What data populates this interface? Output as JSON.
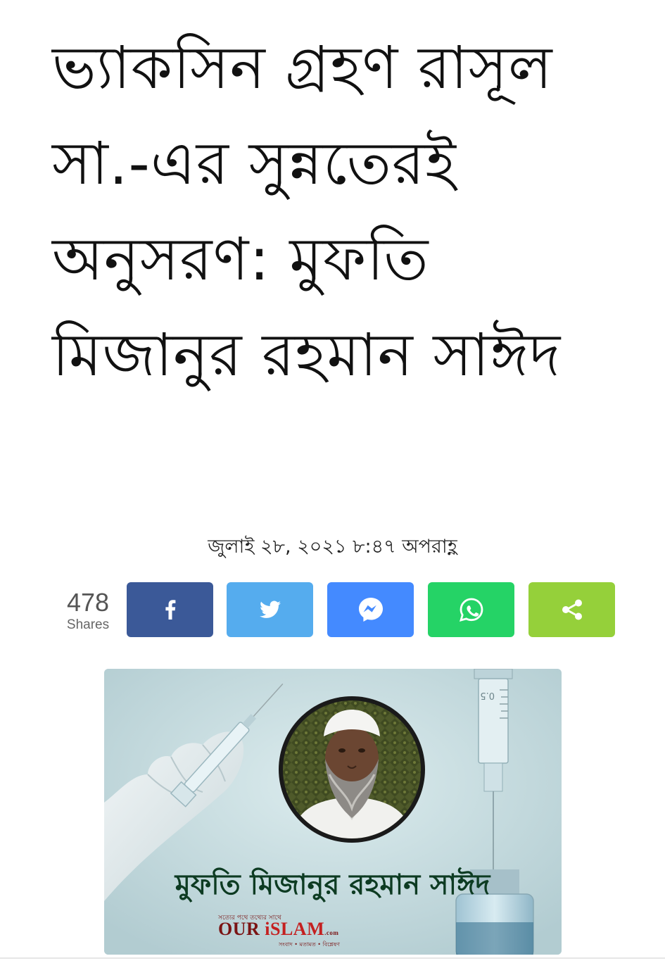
{
  "article": {
    "title": "ভ্যাকসিন গ্রহণ রাসূল সা.-এর সুন্নতেরই অনুসরণ: মুফতি মিজানুর রহমান সাঈদ",
    "date": "জুলাই ২৮, ২০২১ ৮:৪৭ অপরাহ্ণ"
  },
  "share": {
    "count": "478",
    "label": "Shares",
    "buttons": [
      {
        "name": "facebook",
        "icon": "facebook-icon",
        "color": "#3b5998"
      },
      {
        "name": "twitter",
        "icon": "twitter-icon",
        "color": "#55acee"
      },
      {
        "name": "messenger",
        "icon": "messenger-icon",
        "color": "#448aff"
      },
      {
        "name": "whatsapp",
        "icon": "whatsapp-icon",
        "color": "#25d366"
      },
      {
        "name": "share",
        "icon": "share-icon",
        "color": "#95d03a"
      }
    ]
  },
  "hero_image": {
    "caption": "মুফতি মিজানুর রহমান সাঈদ",
    "syringe_mark": "0.5",
    "logo": {
      "tagline_top": "সত্যের পথে তথ্যের সাথে",
      "word_1": "OUR",
      "word_2": "iSLAM",
      "suffix": ".com",
      "tagline_bottom": "সংবাদ • মতামত • বিশ্লেষণ"
    }
  }
}
